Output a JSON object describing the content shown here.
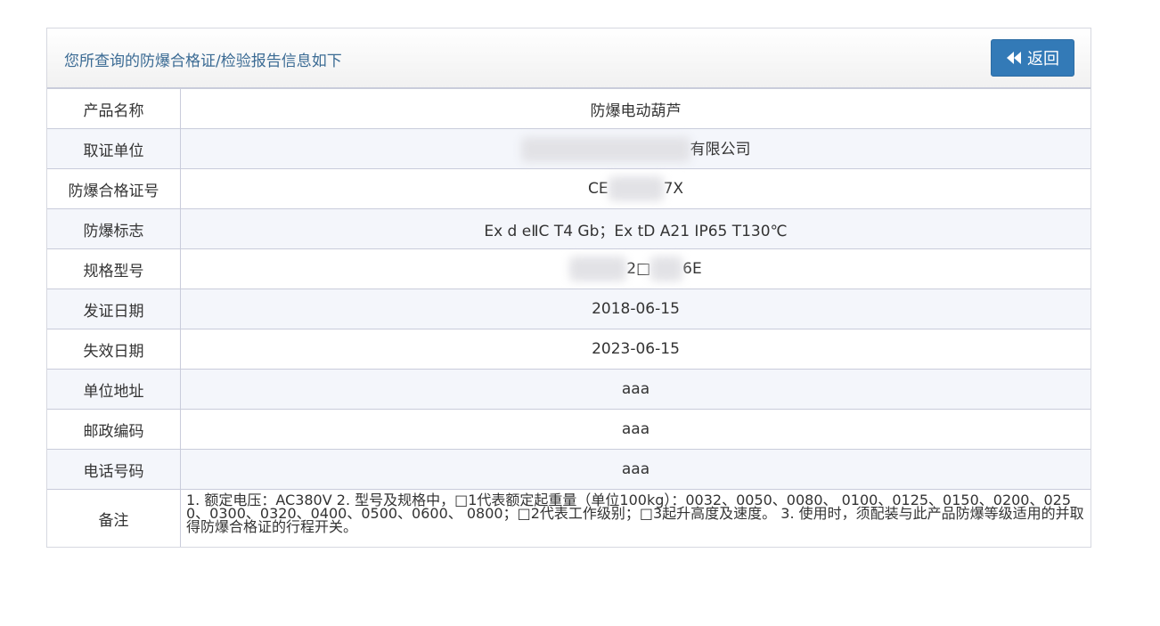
{
  "header": {
    "title": "您所查询的防爆合格证/检验报告信息如下",
    "back_label": "返回"
  },
  "rows": [
    {
      "label": "产品名称",
      "value": "防爆电动葫芦"
    },
    {
      "label": "取证单位",
      "value": "有限公司"
    },
    {
      "label": "防爆合格证号",
      "value_prefix": "CE",
      "value_suffix": "7X"
    },
    {
      "label": "防爆标志",
      "value": "Ex d eⅡC T4 Gb；Ex tD A21 IP65 T130℃"
    },
    {
      "label": "规格型号",
      "value_mid": "2□",
      "value_suffix": "6E"
    },
    {
      "label": "发证日期",
      "value": "2018-06-15"
    },
    {
      "label": "失效日期",
      "value": "2023-06-15"
    },
    {
      "label": "单位地址",
      "value": "aaa"
    },
    {
      "label": "邮政编码",
      "value": "aaa"
    },
    {
      "label": "电话号码",
      "value": "aaa"
    },
    {
      "label": "备注",
      "value": "1. 额定电压：AC380V 2. 型号及规格中，□1代表额定起重量（单位100kg）：0032、0050、0080、 0100、0125、0150、0200、0250、0300、0320、0400、0500、0600、 0800；□2代表工作级别；□3起升高度及速度。 3. 使用时，须配装与此产品防爆等级适用的并取得防爆合格证的行程开关。"
    }
  ],
  "colors": {
    "accent": "#337ab7",
    "title": "#3b6b94",
    "row_alt": "#f4f6fb",
    "border": "#c9ccdb"
  }
}
